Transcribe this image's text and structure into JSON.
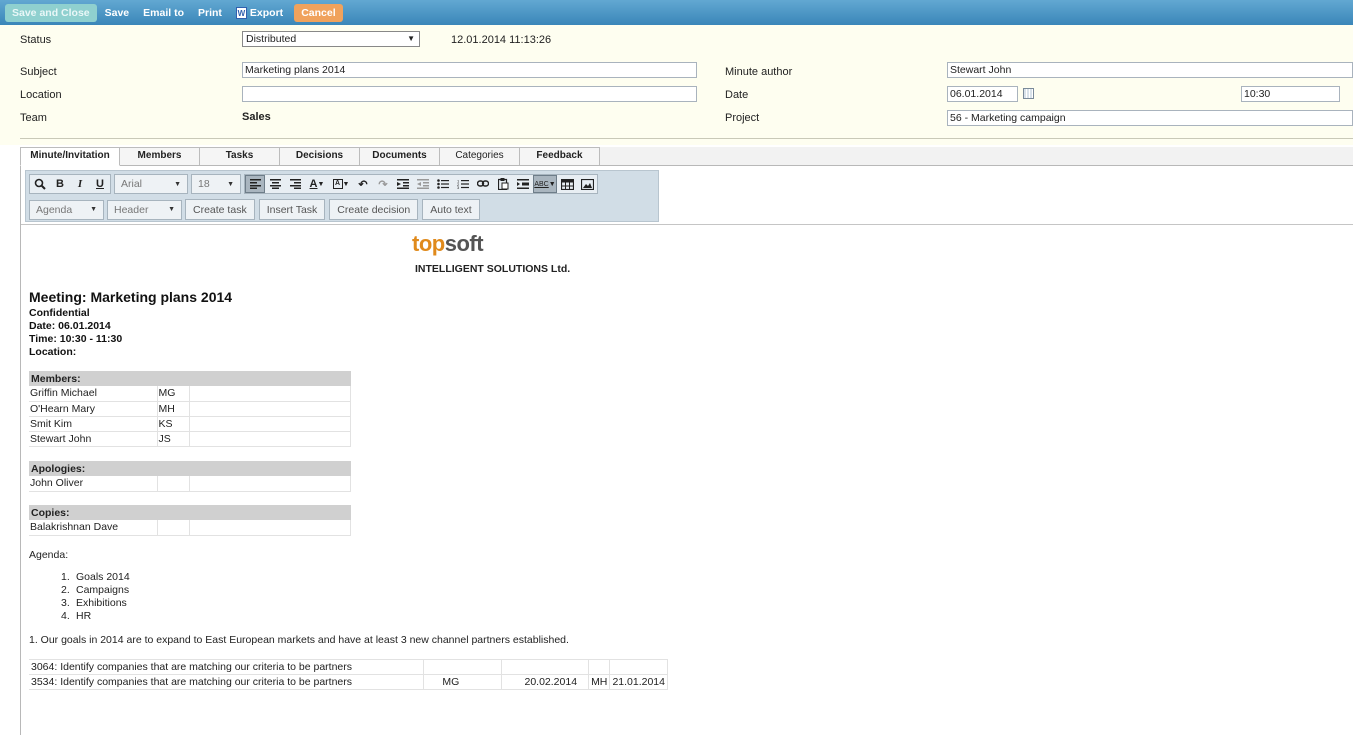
{
  "toolbar": {
    "save_close": "Save and Close",
    "save": "Save",
    "email_to": "Email to",
    "print": "Print",
    "export": "Export",
    "cancel": "Cancel"
  },
  "form": {
    "status_label": "Status",
    "status_value": "Distributed",
    "status_timestamp": "12.01.2014 11:13:26",
    "subject_label": "Subject",
    "subject_value": "Marketing plans 2014",
    "location_label": "Location",
    "location_value": "",
    "team_label": "Team",
    "team_value": "Sales",
    "author_label": "Minute author",
    "author_value": "Stewart John",
    "date_label": "Date",
    "date_value": "06.01.2014",
    "time_value": "10:30",
    "project_label": "Project",
    "project_value": "56 - Marketing campaign"
  },
  "tabs": [
    "Minute/Invitation",
    "Members",
    "Tasks",
    "Decisions",
    "Documents",
    "Categories",
    "Feedback"
  ],
  "editor": {
    "font": "Arial",
    "size": "18",
    "agenda": "Agenda",
    "header": "Header",
    "create_task": "Create task",
    "insert_task": "Insert Task",
    "create_decision": "Create decision",
    "auto_text": "Auto text"
  },
  "document": {
    "logo_top": "top",
    "logo_soft": "soft",
    "logo_sub": "INTELLIGENT SOLUTIONS Ltd.",
    "meeting_title": "Meeting: Marketing plans 2014",
    "confidential": "Confidential",
    "date_line": "Date: 06.01.2014",
    "time_line": "Time: 10:30 - 11:30",
    "location_line": "Location:",
    "members_header": "Members:",
    "members": [
      {
        "name": "Griffin Michael",
        "code": "MG"
      },
      {
        "name": "O'Hearn Mary",
        "code": "MH"
      },
      {
        "name": "Smit Kim",
        "code": "KS"
      },
      {
        "name": "Stewart John",
        "code": "JS"
      }
    ],
    "apologies_header": "Apologies:",
    "apologies": [
      {
        "name": "John Oliver"
      }
    ],
    "copies_header": "Copies:",
    "copies": [
      {
        "name": "Balakrishnan Dave"
      }
    ],
    "agenda_label": "Agenda:",
    "agenda_items": [
      "Goals 2014",
      "Campaigns",
      "Exhibitions",
      "HR"
    ],
    "goal_text": "1.  Our goals in 2014 are to expand to East European markets and have at least 3 new channel partners established.",
    "tasks": [
      {
        "text": "3064: Identify companies that are matching our criteria to be partners",
        "resp": "",
        "due": "",
        "by": "",
        "created": ""
      },
      {
        "text": "3534: Identify companies that are matching our criteria to be partners",
        "resp": "MG",
        "due": "20.02.2014",
        "by": "MH",
        "created": "21.01.2014"
      }
    ]
  }
}
